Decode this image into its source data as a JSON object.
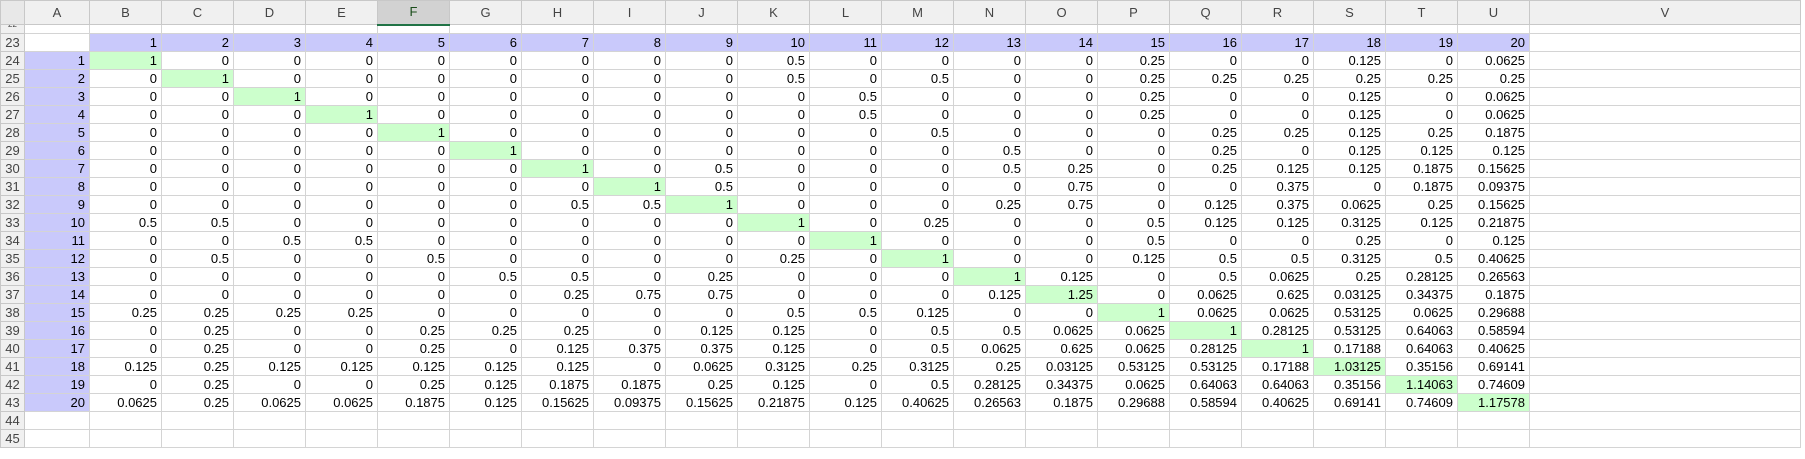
{
  "sheet": {
    "columns": [
      "A",
      "B",
      "C",
      "D",
      "E",
      "F",
      "G",
      "H",
      "I",
      "J",
      "K",
      "L",
      "M",
      "N",
      "O",
      "P",
      "Q",
      "R",
      "S",
      "T",
      "U",
      "V"
    ],
    "selected_column": "F",
    "top_row_number": "22",
    "bottom_rows": [
      "44",
      "45"
    ],
    "header_row": {
      "row_number": "23",
      "labels": [
        "1",
        "2",
        "3",
        "4",
        "5",
        "6",
        "7",
        "8",
        "9",
        "10",
        "11",
        "12",
        "13",
        "14",
        "15",
        "16",
        "17",
        "18",
        "19",
        "20"
      ]
    },
    "colors": {
      "label_fill": "#c9c9fb",
      "diagonal_fill": "#ccffcc",
      "selected_header": "#217346"
    },
    "rows": [
      {
        "row_number": "24",
        "label": "1",
        "values": [
          "1",
          "0",
          "0",
          "0",
          "0",
          "0",
          "0",
          "0",
          "0",
          "0.5",
          "0",
          "0",
          "0",
          "0",
          "0.25",
          "0",
          "0",
          "0.125",
          "0",
          "0.0625"
        ]
      },
      {
        "row_number": "25",
        "label": "2",
        "values": [
          "0",
          "1",
          "0",
          "0",
          "0",
          "0",
          "0",
          "0",
          "0",
          "0.5",
          "0",
          "0.5",
          "0",
          "0",
          "0.25",
          "0.25",
          "0.25",
          "0.25",
          "0.25",
          "0.25"
        ]
      },
      {
        "row_number": "26",
        "label": "3",
        "values": [
          "0",
          "0",
          "1",
          "0",
          "0",
          "0",
          "0",
          "0",
          "0",
          "0",
          "0.5",
          "0",
          "0",
          "0",
          "0.25",
          "0",
          "0",
          "0.125",
          "0",
          "0.0625"
        ]
      },
      {
        "row_number": "27",
        "label": "4",
        "values": [
          "0",
          "0",
          "0",
          "1",
          "0",
          "0",
          "0",
          "0",
          "0",
          "0",
          "0.5",
          "0",
          "0",
          "0",
          "0.25",
          "0",
          "0",
          "0.125",
          "0",
          "0.0625"
        ]
      },
      {
        "row_number": "28",
        "label": "5",
        "values": [
          "0",
          "0",
          "0",
          "0",
          "1",
          "0",
          "0",
          "0",
          "0",
          "0",
          "0",
          "0.5",
          "0",
          "0",
          "0",
          "0.25",
          "0.25",
          "0.125",
          "0.25",
          "0.1875"
        ]
      },
      {
        "row_number": "29",
        "label": "6",
        "values": [
          "0",
          "0",
          "0",
          "0",
          "0",
          "1",
          "0",
          "0",
          "0",
          "0",
          "0",
          "0",
          "0.5",
          "0",
          "0",
          "0.25",
          "0",
          "0.125",
          "0.125",
          "0.125"
        ]
      },
      {
        "row_number": "30",
        "label": "7",
        "values": [
          "0",
          "0",
          "0",
          "0",
          "0",
          "0",
          "1",
          "0",
          "0.5",
          "0",
          "0",
          "0",
          "0.5",
          "0.25",
          "0",
          "0.25",
          "0.125",
          "0.125",
          "0.1875",
          "0.15625"
        ]
      },
      {
        "row_number": "31",
        "label": "8",
        "values": [
          "0",
          "0",
          "0",
          "0",
          "0",
          "0",
          "0",
          "1",
          "0.5",
          "0",
          "0",
          "0",
          "0",
          "0.75",
          "0",
          "0",
          "0.375",
          "0",
          "0.1875",
          "0.09375"
        ]
      },
      {
        "row_number": "32",
        "label": "9",
        "values": [
          "0",
          "0",
          "0",
          "0",
          "0",
          "0",
          "0.5",
          "0.5",
          "1",
          "0",
          "0",
          "0",
          "0.25",
          "0.75",
          "0",
          "0.125",
          "0.375",
          "0.0625",
          "0.25",
          "0.15625"
        ]
      },
      {
        "row_number": "33",
        "label": "10",
        "values": [
          "0.5",
          "0.5",
          "0",
          "0",
          "0",
          "0",
          "0",
          "0",
          "0",
          "1",
          "0",
          "0.25",
          "0",
          "0",
          "0.5",
          "0.125",
          "0.125",
          "0.3125",
          "0.125",
          "0.21875"
        ]
      },
      {
        "row_number": "34",
        "label": "11",
        "values": [
          "0",
          "0",
          "0.5",
          "0.5",
          "0",
          "0",
          "0",
          "0",
          "0",
          "0",
          "1",
          "0",
          "0",
          "0",
          "0.5",
          "0",
          "0",
          "0.25",
          "0",
          "0.125"
        ]
      },
      {
        "row_number": "35",
        "label": "12",
        "values": [
          "0",
          "0.5",
          "0",
          "0",
          "0.5",
          "0",
          "0",
          "0",
          "0",
          "0.25",
          "0",
          "1",
          "0",
          "0",
          "0.125",
          "0.5",
          "0.5",
          "0.3125",
          "0.5",
          "0.40625"
        ]
      },
      {
        "row_number": "36",
        "label": "13",
        "values": [
          "0",
          "0",
          "0",
          "0",
          "0",
          "0.5",
          "0.5",
          "0",
          "0.25",
          "0",
          "0",
          "0",
          "1",
          "0.125",
          "0",
          "0.5",
          "0.0625",
          "0.25",
          "0.28125",
          "0.26563"
        ]
      },
      {
        "row_number": "37",
        "label": "14",
        "values": [
          "0",
          "0",
          "0",
          "0",
          "0",
          "0",
          "0.25",
          "0.75",
          "0.75",
          "0",
          "0",
          "0",
          "0.125",
          "1.25",
          "0",
          "0.0625",
          "0.625",
          "0.03125",
          "0.34375",
          "0.1875"
        ]
      },
      {
        "row_number": "38",
        "label": "15",
        "values": [
          "0.25",
          "0.25",
          "0.25",
          "0.25",
          "0",
          "0",
          "0",
          "0",
          "0",
          "0.5",
          "0.5",
          "0.125",
          "0",
          "0",
          "1",
          "0.0625",
          "0.0625",
          "0.53125",
          "0.0625",
          "0.29688"
        ]
      },
      {
        "row_number": "39",
        "label": "16",
        "values": [
          "0",
          "0.25",
          "0",
          "0",
          "0.25",
          "0.25",
          "0.25",
          "0",
          "0.125",
          "0.125",
          "0",
          "0.5",
          "0.5",
          "0.0625",
          "0.0625",
          "1",
          "0.28125",
          "0.53125",
          "0.64063",
          "0.58594"
        ]
      },
      {
        "row_number": "40",
        "label": "17",
        "values": [
          "0",
          "0.25",
          "0",
          "0",
          "0.25",
          "0",
          "0.125",
          "0.375",
          "0.375",
          "0.125",
          "0",
          "0.5",
          "0.0625",
          "0.625",
          "0.0625",
          "0.28125",
          "1",
          "0.17188",
          "0.64063",
          "0.40625"
        ]
      },
      {
        "row_number": "41",
        "label": "18",
        "values": [
          "0.125",
          "0.25",
          "0.125",
          "0.125",
          "0.125",
          "0.125",
          "0.125",
          "0",
          "0.0625",
          "0.3125",
          "0.25",
          "0.3125",
          "0.25",
          "0.03125",
          "0.53125",
          "0.53125",
          "0.17188",
          "1.03125",
          "0.35156",
          "0.69141"
        ]
      },
      {
        "row_number": "42",
        "label": "19",
        "values": [
          "0",
          "0.25",
          "0",
          "0",
          "0.25",
          "0.125",
          "0.1875",
          "0.1875",
          "0.25",
          "0.125",
          "0",
          "0.5",
          "0.28125",
          "0.34375",
          "0.0625",
          "0.64063",
          "0.64063",
          "0.35156",
          "1.14063",
          "0.74609"
        ]
      },
      {
        "row_number": "43",
        "label": "20",
        "values": [
          "0.0625",
          "0.25",
          "0.0625",
          "0.0625",
          "0.1875",
          "0.125",
          "0.15625",
          "0.09375",
          "0.15625",
          "0.21875",
          "0.125",
          "0.40625",
          "0.26563",
          "0.1875",
          "0.29688",
          "0.58594",
          "0.40625",
          "0.69141",
          "0.74609",
          "1.17578"
        ]
      }
    ]
  }
}
